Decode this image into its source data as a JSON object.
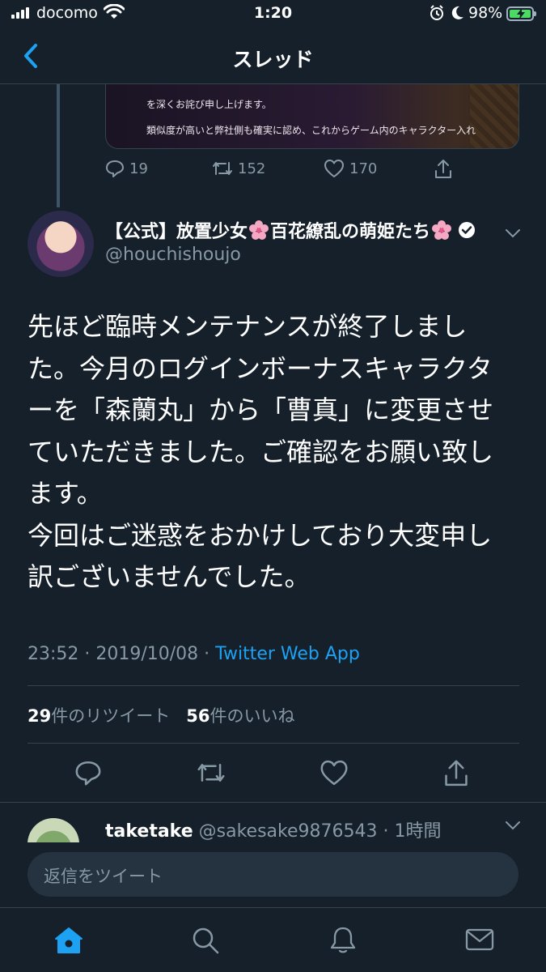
{
  "status_bar": {
    "carrier": "docomo",
    "time": "1:20",
    "battery_percent": "98%"
  },
  "header": {
    "title": "スレッド"
  },
  "previous_tweet": {
    "media_text_line1": "を深くお詫び申し上げます。",
    "media_text_line2": "類似度が高いと弊社側も確実に認め、これからゲーム内のキャラクター入れ",
    "reply_count": "19",
    "retweet_count": "152",
    "like_count": "170"
  },
  "tweet": {
    "author_name_part1": "【公式】放置少女",
    "author_name_part2": "百花繚乱の萌姫たち",
    "handle": "@houchishoujo",
    "text_lines": [
      "先ほど臨時メンテナンスが終了しまし",
      "た。今月のログインボーナスキャラクタ",
      "ーを「森蘭丸」から「曹真」に変更させ",
      "ていただきました。ご確認をお願い致し",
      "ます。",
      "今回はご迷惑をおかけしており大変申し",
      "訳ございませんでした。"
    ],
    "timestamp": "23:52 · 2019/10/08 · ",
    "source": "Twitter Web App",
    "retweets": "29",
    "retweets_label": "件のリツイート",
    "likes": "56",
    "likes_label": "件のいいね"
  },
  "reply": {
    "name": "taketake",
    "handle_time": " @sakesake9876543 · 1時間"
  },
  "reply_bar": {
    "placeholder": "返信をツイート"
  },
  "tabs": [
    "home-icon",
    "search-icon",
    "notifications-icon",
    "messages-icon"
  ],
  "colors": {
    "background": "#15202b",
    "accent": "#1da1f2",
    "secondary_text": "#8899a6",
    "divider": "#38444d"
  }
}
